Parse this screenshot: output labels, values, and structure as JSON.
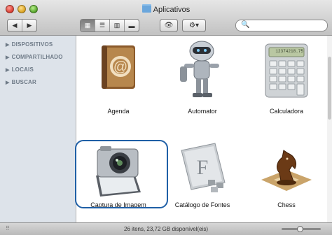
{
  "window": {
    "title": "Aplicativos"
  },
  "toolbar": {
    "back_icon": "back-arrow-icon",
    "forward_icon": "forward-arrow-icon",
    "view_modes": [
      "icon-view-icon",
      "list-view-icon",
      "column-view-icon",
      "coverflow-view-icon"
    ],
    "active_view": "icon-view-icon",
    "quicklook_icon": "eye-icon",
    "action_icon": "gear-icon",
    "search": {
      "placeholder": "",
      "icon": "magnifier-icon"
    }
  },
  "sidebar": {
    "items": [
      {
        "label": "DISPOSITIVOS"
      },
      {
        "label": "COMPARTILHADO"
      },
      {
        "label": "LOCAIS"
      },
      {
        "label": "BUSCAR"
      }
    ]
  },
  "apps": [
    {
      "label": "Agenda",
      "icon": "address-book-icon",
      "selected": false
    },
    {
      "label": "Automator",
      "icon": "automator-robot-icon",
      "selected": false
    },
    {
      "label": "Calculadora",
      "icon": "calculator-icon",
      "selected": false,
      "display": "12374218.75"
    },
    {
      "label": "Captura de Imagem",
      "icon": "image-capture-camera-icon",
      "selected": true
    },
    {
      "label": "Catálogo de Fontes",
      "icon": "font-book-icon",
      "selected": false
    },
    {
      "label": "Chess",
      "icon": "chess-knight-icon",
      "selected": false
    }
  ],
  "status": {
    "text": "26 itens, 23,72 GB disponível(eis)"
  },
  "colors": {
    "selection_ring": "#1f5fa6",
    "sidebar_bg": "#dde3ea",
    "sidebar_text": "#6f7b88"
  }
}
